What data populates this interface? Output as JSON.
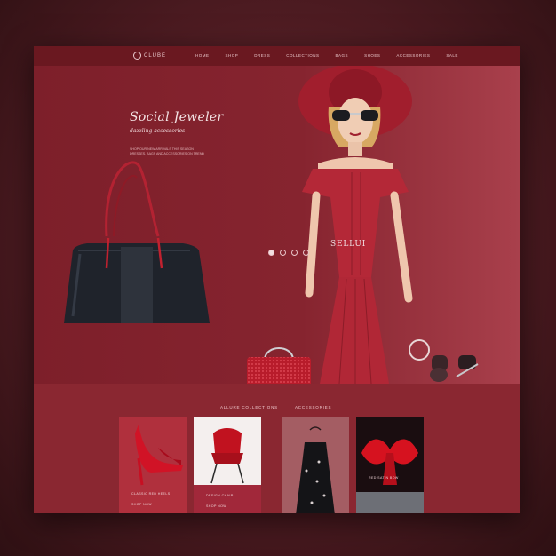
{
  "nav": {
    "brand": "CLUBE",
    "items": [
      "HOME",
      "SHOP",
      "DRESS",
      "COLLECTIONS",
      "BAGS",
      "SHOES",
      "ACCESSORIES",
      "SALE"
    ]
  },
  "hero": {
    "title": "Social Jeweler",
    "subtitle": "dazzling accessories",
    "text_lines": [
      "SHOP OUR NEW ARRIVALS THIS SEASON",
      "DRESSES, BAGS AND ACCESSORIES ON TREND"
    ],
    "caption": "SELLUI"
  },
  "section": {
    "label_left": "ALLURE COLLECTIONS",
    "label_right": "ACCESSORIES"
  },
  "products": [
    {
      "name": "red-heels-card",
      "caption_1": "CLASSIC RED HEELS",
      "caption_2": "SHOP NOW"
    },
    {
      "name": "red-chair-card",
      "caption_1": "DESIGN CHAIR",
      "caption_2": "SHOP NOW"
    },
    {
      "name": "black-dress-card",
      "caption_1": "",
      "caption_2": ""
    },
    {
      "name": "red-satin-card",
      "caption_1": "RED SATIN BOW",
      "caption_2": ""
    }
  ],
  "colors": {
    "brand_red": "#7c1e28",
    "nav_bg": "#6a1820",
    "accent_light": "#f4e4e5"
  }
}
